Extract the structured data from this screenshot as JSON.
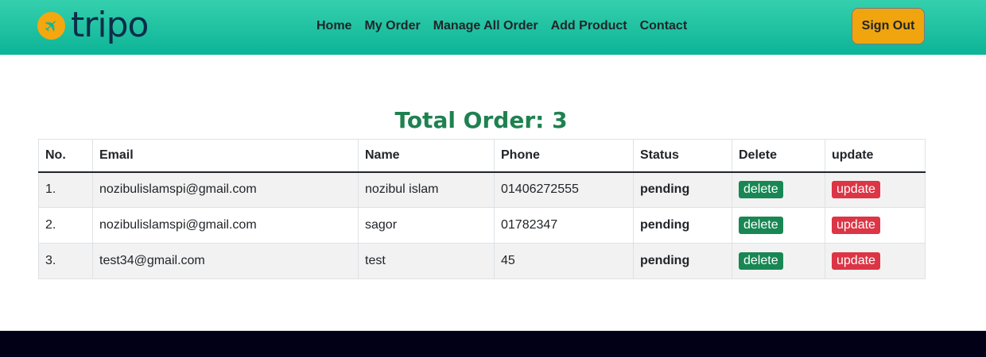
{
  "nav": {
    "logo": "tripo",
    "links": [
      "Home",
      "My Order",
      "Manage All Order",
      "Add Product",
      "Contact"
    ],
    "signout": "Sign Out"
  },
  "main": {
    "title": "Total Order: 3",
    "headers": [
      "No.",
      "Email",
      "Name",
      "Phone",
      "Status",
      "Delete",
      "update"
    ],
    "rows": [
      {
        "no": "1.",
        "email": "nozibulislamspi@gmail.com",
        "name": "nozibul islam",
        "phone": "01406272555",
        "status": "pending",
        "delete": "delete",
        "update": "update"
      },
      {
        "no": "2.",
        "email": "nozibulislamspi@gmail.com",
        "name": "sagor",
        "phone": "01782347",
        "status": "pending",
        "delete": "delete",
        "update": "update"
      },
      {
        "no": "3.",
        "email": "test34@gmail.com",
        "name": "test",
        "phone": "45",
        "status": "pending",
        "delete": "delete",
        "update": "update"
      }
    ]
  },
  "colors": {
    "nav": "#1bc2a2",
    "accent": "#f0a50e",
    "delete": "#198754",
    "update": "#dc3545",
    "title": "#1e8150"
  }
}
